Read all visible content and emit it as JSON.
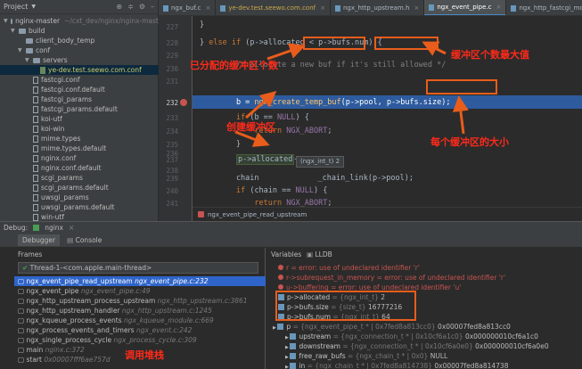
{
  "sidebar": {
    "header_title": "Project",
    "items": [
      {
        "label": "nginx-master",
        "path": "~/cxt_dev/nginx/nginx-mast",
        "kind": "folder",
        "indent": 0,
        "arrow": "▼"
      },
      {
        "label": "build",
        "kind": "folder",
        "indent": 1,
        "arrow": "▼"
      },
      {
        "label": "client_body_temp",
        "kind": "folder",
        "indent": 2,
        "arrow": ""
      },
      {
        "label": "conf",
        "kind": "folder",
        "indent": 2,
        "arrow": "▼"
      },
      {
        "label": "servers",
        "kind": "folder",
        "indent": 3,
        "arrow": "▼"
      },
      {
        "label": "ye-dev.test.seewo.com.conf",
        "kind": "file-green",
        "indent": 4,
        "arrow": "",
        "selected": true
      },
      {
        "label": "fastcgi.conf",
        "kind": "file",
        "indent": 3,
        "arrow": ""
      },
      {
        "label": "fastcgi.conf.default",
        "kind": "file",
        "indent": 3,
        "arrow": ""
      },
      {
        "label": "fastcgi_params",
        "kind": "file",
        "indent": 3,
        "arrow": ""
      },
      {
        "label": "fastcgi_params.default",
        "kind": "file",
        "indent": 3,
        "arrow": ""
      },
      {
        "label": "koi-utf",
        "kind": "file",
        "indent": 3,
        "arrow": ""
      },
      {
        "label": "koi-win",
        "kind": "file",
        "indent": 3,
        "arrow": ""
      },
      {
        "label": "mime.types",
        "kind": "file",
        "indent": 3,
        "arrow": ""
      },
      {
        "label": "mime.types.default",
        "kind": "file",
        "indent": 3,
        "arrow": ""
      },
      {
        "label": "nginx.conf",
        "kind": "file",
        "indent": 3,
        "arrow": ""
      },
      {
        "label": "nginx.conf.default",
        "kind": "file",
        "indent": 3,
        "arrow": ""
      },
      {
        "label": "scgi_params",
        "kind": "file",
        "indent": 3,
        "arrow": ""
      },
      {
        "label": "scgi_params.default",
        "kind": "file",
        "indent": 3,
        "arrow": ""
      },
      {
        "label": "uwsgi_params",
        "kind": "file",
        "indent": 3,
        "arrow": ""
      },
      {
        "label": "uwsgi_params.default",
        "kind": "file",
        "indent": 3,
        "arrow": ""
      },
      {
        "label": "win-utf",
        "kind": "file",
        "indent": 3,
        "arrow": ""
      }
    ]
  },
  "tabs": [
    {
      "label": "ngx_buf.c",
      "active": false,
      "yellow": false
    },
    {
      "label": "ye-dev.test.seewo.com.conf",
      "active": false,
      "yellow": true
    },
    {
      "label": "ngx_http_upstream.h",
      "active": false,
      "yellow": false
    },
    {
      "label": "ngx_event_pipe.c",
      "active": true,
      "yellow": false
    },
    {
      "label": "ngx_http_fastcgi_module.c",
      "active": false,
      "yellow": false
    },
    {
      "label": "ngx_http_req",
      "active": false,
      "yellow": false
    }
  ],
  "editor": {
    "line_numbers": [
      "226",
      "227",
      "228",
      "229",
      "230",
      "231",
      "232",
      "233",
      "234",
      "235",
      "236",
      "237",
      "238",
      "239",
      "240",
      "241",
      "242"
    ],
    "lines": {
      "l227": "}",
      "l228_a": "} ",
      "l228_kw": "else if",
      "l228_b": " (",
      "l228_c": "p->allocated",
      "l228_d": " < ",
      "l228_e": "p->bufs.num",
      "l228_f": ") {",
      "l230": "        /* allocate a new buf if it's still allowed */",
      "l232_a": "        b = ",
      "l232_fn": "ngx_create_temp_buf",
      "l232_b": "(p->pool, ",
      "l232_c": "p->bufs.size",
      "l232_d": ");",
      "l233_a": "        ",
      "l233_kw": "if",
      "l233_b": " (b == ",
      "l233_mac": "NULL",
      "l233_c": ") {",
      "l234_a": "            ",
      "l234_kw": "return",
      "l234_mac": " NGX_ABORT",
      "l234_b": ";",
      "l235": "        }",
      "l237_a": "        ",
      "l237_b": "p->allocated",
      "l237_c": "++;",
      "l239_a": "        chain",
      "l239_b": "_chain_link(p->pool);",
      "l240_a": "        ",
      "l240_kw": "if",
      "l240_b": " (chain == ",
      "l240_mac": "NULL",
      "l240_c": ") {",
      "l241_a": "            ",
      "l241_kw": "return",
      "l241_mac": " NGX_ABORT",
      "l241_b": ";",
      "l242": "        }"
    },
    "tooltip": "(ngx_int_t) 2",
    "breadcrumb": "ngx_event_pipe_read_upstream"
  },
  "annotations": {
    "allocated": "已分配的缓冲区个数",
    "bufs_num": "缓冲区个数最大值",
    "create_buf": "创建缓冲区",
    "buf_size": "每个缓冲区的大小",
    "call_stack": "调用堆栈"
  },
  "debug": {
    "label": "Debug:",
    "config": "nginx",
    "tabs": [
      "Debugger",
      "Console"
    ],
    "lldb_label": "LLDB",
    "frames_title": "Frames",
    "variables_title": "Variables",
    "thread": "Thread-1-<com.apple.main-thread>",
    "frames": [
      {
        "fn": "ngx_event_pipe_read_upstream",
        "loc": "ngx_event_pipe.c:232",
        "selected": true
      },
      {
        "fn": "ngx_event_pipe",
        "loc": "ngx_event_pipe.c:49",
        "selected": false
      },
      {
        "fn": "ngx_http_upstream_process_upstream",
        "loc": "ngx_http_upstream.c:3861",
        "selected": false
      },
      {
        "fn": "ngx_http_upstream_handler",
        "loc": "ngx_http_upstream.c:1245",
        "selected": false
      },
      {
        "fn": "ngx_kqueue_process_events",
        "loc": "ngx_kqueue_module.c:669",
        "selected": false
      },
      {
        "fn": "ngx_process_events_and_timers",
        "loc": "ngx_event.c:242",
        "selected": false
      },
      {
        "fn": "ngx_single_process_cycle",
        "loc": "ngx_process_cycle.c:309",
        "selected": false
      },
      {
        "fn": "main",
        "loc": "nginx.c:372",
        "selected": false
      },
      {
        "fn": "start",
        "loc": "0x00007fff6ae757d",
        "selected": false
      }
    ],
    "variables": [
      {
        "text": "r = error: use of undeclared identifier 'r'",
        "type": "err"
      },
      {
        "text": "r->subrequest_in_memory = error: use of undeclared identifier 'r'",
        "type": "err"
      },
      {
        "text": "u->buffering = error: use of undeclared identifier 'u'",
        "type": "err"
      },
      {
        "name": "p->allocated",
        "meta": " = {ngx_int_t} ",
        "value": "2",
        "type": "val"
      },
      {
        "name": "p->bufs.size",
        "meta": " = {size_t} ",
        "value": "16777216",
        "type": "val"
      },
      {
        "name": "p->bufs.num",
        "meta": " = {ngx_int_t} ",
        "value": "64",
        "type": "val"
      },
      {
        "name": "p",
        "meta": " = {ngx_event_pipe_t * | 0x7fed8a813cc0} ",
        "value": "0x00007fed8a813cc0",
        "type": "val"
      },
      {
        "name": "upstream",
        "meta": " = {ngx_connection_t * | 0x10cf6a1c0} ",
        "value": "0x000000010cf6a1c0",
        "type": "val"
      },
      {
        "name": "downstream",
        "meta": " = {ngx_connection_t * | 0x10cf6a0e0} ",
        "value": "0x000000010cf6a0e0",
        "type": "val"
      },
      {
        "name": "free_raw_bufs",
        "meta": " = {ngx_chain_t * | 0x0} ",
        "value": "NULL",
        "type": "val"
      },
      {
        "name": "in",
        "meta": " = {ngx_chain_t * | 0x7fed8a814738} ",
        "value": "0x00007fed8a814738",
        "type": "val"
      }
    ]
  },
  "colors": {
    "accent": "#2f65ca",
    "annotation": "#ff2a1a",
    "box": "#e85d1c",
    "highlight": "#2d5b9e"
  }
}
